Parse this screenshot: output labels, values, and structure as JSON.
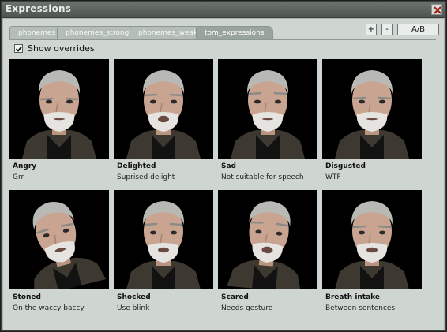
{
  "window": {
    "title": "Expressions"
  },
  "tabs": [
    {
      "label": "phonemes"
    },
    {
      "label": "phonemes_strong"
    },
    {
      "label": "phonemes_weak"
    },
    {
      "label": "tom_expressions"
    }
  ],
  "toolbar": {
    "plus_label": "+",
    "minus_label": "-",
    "ab_label": "A/B"
  },
  "override": {
    "label": "Show overrides",
    "checked": true
  },
  "expressions": [
    {
      "name": "Angry",
      "description": "Grr",
      "icon": "angry-face"
    },
    {
      "name": "Delighted",
      "description": "Suprised delight",
      "icon": "delighted-face"
    },
    {
      "name": "Sad",
      "description": "Not suitable for speech",
      "icon": "sad-face"
    },
    {
      "name": "Disgusted",
      "description": "WTF",
      "icon": "disgusted-face"
    },
    {
      "name": "Stoned",
      "description": "On the waccy baccy",
      "icon": "stoned-face"
    },
    {
      "name": "Shocked",
      "description": "Use blink",
      "icon": "shocked-face"
    },
    {
      "name": "Scared",
      "description": "Needs gesture",
      "icon": "scared-face"
    },
    {
      "name": "Breath intake",
      "description": "Between sentences",
      "icon": "breath-intake-face"
    }
  ],
  "colors": {
    "title_bar": "#5a615d",
    "panel": "#cfd6d1",
    "tab_active": "#9aa49e",
    "portrait_bg": "#000000"
  }
}
